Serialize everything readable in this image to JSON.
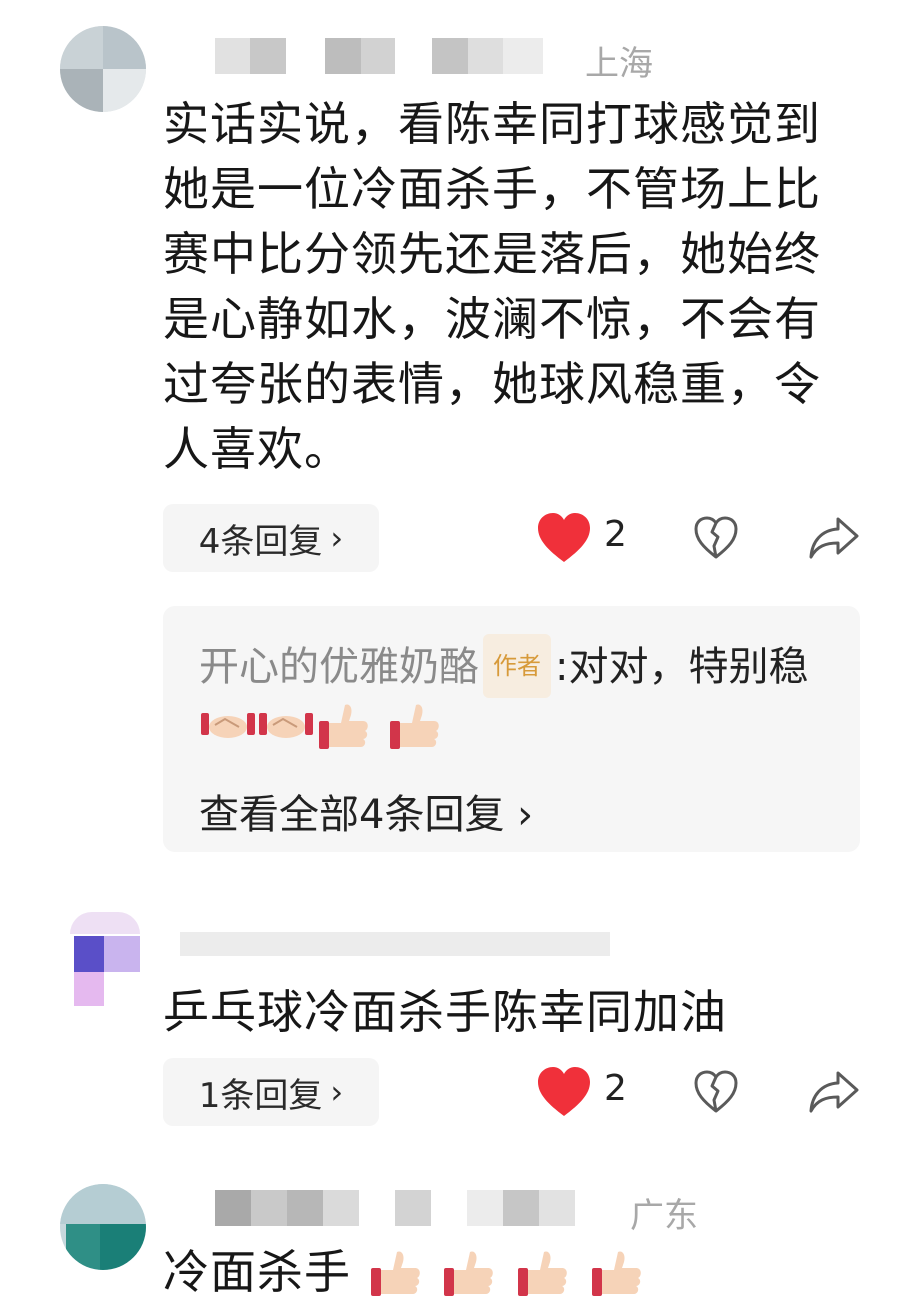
{
  "comments": [
    {
      "location": "上海",
      "text": "实话实说，看陈幸同打球感觉到她是一位冷面杀手，不管场上比赛中比分领先还是落后，她始终是心静如水，波澜不惊，不会有过夸张的表情，她球风稳重，令人喜欢。",
      "replies_label": "4条回复",
      "likes": "2",
      "reply_preview": {
        "author": "开心的优雅奶酪",
        "badge": "作者",
        "text": ":对对，特别稳",
        "view_all": "查看全部4条回复"
      }
    },
    {
      "location": "",
      "text": "乒乓球冷面杀手陈幸同加油",
      "replies_label": "1条回复",
      "likes": "2"
    },
    {
      "location": "广东",
      "text": "冷面杀手"
    }
  ],
  "icons": {
    "chevron": "›",
    "like": "heart-icon",
    "dislike": "broken-heart-icon",
    "share": "share-icon"
  },
  "colors": {
    "heart": "#f0303a",
    "pill_bg": "#f5f5f5",
    "badge_text": "#d79a3a"
  }
}
